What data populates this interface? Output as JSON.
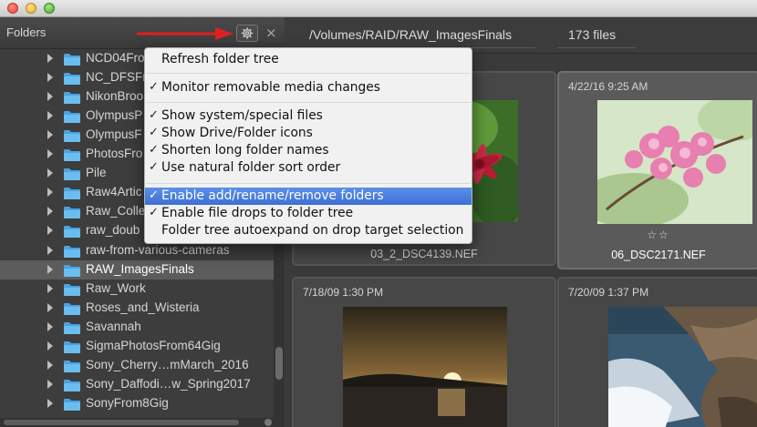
{
  "panel": {
    "title": "Folders",
    "close_glyph": "×"
  },
  "icons": {
    "settings": "gear-icon",
    "close": "close-icon",
    "folder": "folder-icon",
    "expand": "disclosure-triangle-icon",
    "annotation": "red-arrow-icon"
  },
  "colors": {
    "accent": "#3d70d6",
    "folder": "#5aaee8",
    "arrow": "#e02020"
  },
  "folders": [
    {
      "label": "NCD04Fro",
      "selected": false
    },
    {
      "label": "NC_DFSFro",
      "selected": false
    },
    {
      "label": "NikonBroo",
      "selected": false
    },
    {
      "label": "OlympusP",
      "selected": false
    },
    {
      "label": "OlympusF",
      "selected": false
    },
    {
      "label": "PhotosFro",
      "selected": false
    },
    {
      "label": "Pile",
      "selected": false
    },
    {
      "label": "Raw4Artic",
      "selected": false
    },
    {
      "label": "Raw_Colle",
      "selected": false
    },
    {
      "label": "raw_doub",
      "selected": false
    },
    {
      "label": "raw-from-various-cameras",
      "selected": false
    },
    {
      "label": "RAW_ImagesFinals",
      "selected": true
    },
    {
      "label": "Raw_Work",
      "selected": false
    },
    {
      "label": "Roses_and_Wisteria",
      "selected": false
    },
    {
      "label": "Savannah",
      "selected": false
    },
    {
      "label": "SigmaPhotosFrom64Gig",
      "selected": false
    },
    {
      "label": "Sony_Cherry…mMarch_2016",
      "selected": false
    },
    {
      "label": "Sony_Daffodi…w_Spring2017",
      "selected": false
    },
    {
      "label": "SonyFrom8Gig",
      "selected": false
    }
  ],
  "browser": {
    "path": "/Volumes/RAID/RAW_ImagesFinals",
    "count": "173 files"
  },
  "tiles": [
    {
      "date": "",
      "filename": "03_2_DSC4139.NEF",
      "stars": "",
      "selected": false
    },
    {
      "date": "4/22/16 9:25 AM",
      "filename": "06_DSC2171.NEF",
      "stars": "☆☆",
      "selected": true
    },
    {
      "date": "7/18/09 1:30 PM",
      "filename": "",
      "stars": "",
      "selected": false
    },
    {
      "date": "7/20/09 1:37 PM",
      "filename": "",
      "stars": "",
      "selected": false
    }
  ],
  "menu": {
    "items": [
      {
        "label": "Refresh folder tree",
        "checked": false,
        "highlighted": false
      },
      {
        "label": "Monitor removable media changes",
        "checked": true,
        "highlighted": false
      },
      {
        "label": "Show system/special files",
        "checked": true,
        "highlighted": false
      },
      {
        "label": "Show Drive/Folder icons",
        "checked": true,
        "highlighted": false
      },
      {
        "label": "Shorten long folder names",
        "checked": true,
        "highlighted": false
      },
      {
        "label": "Use natural folder sort order",
        "checked": true,
        "highlighted": false
      },
      {
        "label": "Enable add/rename/remove folders",
        "checked": true,
        "highlighted": true
      },
      {
        "label": "Enable file drops to folder tree",
        "checked": true,
        "highlighted": false
      },
      {
        "label": "Folder tree autoexpand on drop target selection",
        "checked": false,
        "highlighted": false
      }
    ]
  }
}
